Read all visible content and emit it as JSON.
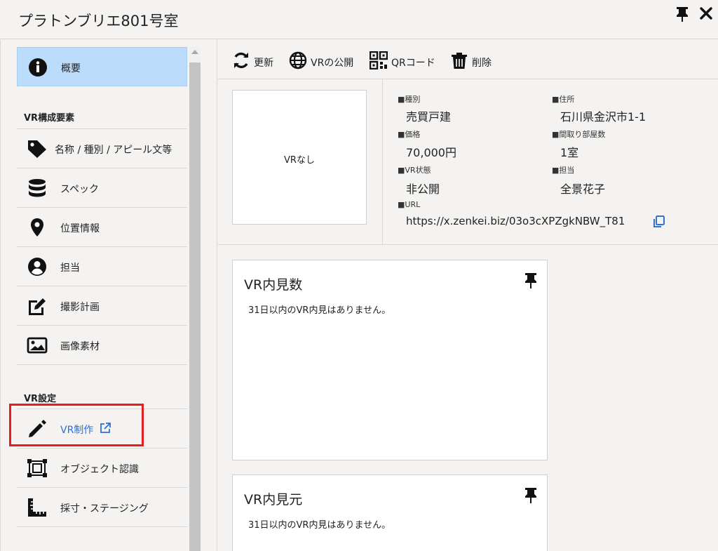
{
  "window": {
    "title": "プラトンブリエ801号室"
  },
  "sidebar": {
    "top_item": {
      "label": "概要",
      "icon": "info-circle-icon"
    },
    "section1": "VR構成要素",
    "section1_items": [
      {
        "label": "名称 / 種別 / アピール文等",
        "icon": "tag-icon"
      },
      {
        "label": "スペック",
        "icon": "database-icon"
      },
      {
        "label": "位置情報",
        "icon": "map-marker-icon"
      },
      {
        "label": "担当",
        "icon": "user-circle-icon"
      },
      {
        "label": "撮影計画",
        "icon": "edit-icon"
      },
      {
        "label": "画像素材",
        "icon": "image-icon"
      }
    ],
    "section2": "VR設定",
    "section2_items": [
      {
        "label": "VR制作",
        "icon": "pencil-icon",
        "trailing_icon": "external-link-icon"
      },
      {
        "label": "オブジェクト認識",
        "icon": "object-recognition-icon"
      },
      {
        "label": "採寸・ステージング",
        "icon": "ruler-icon"
      }
    ]
  },
  "toolbar": {
    "buttons": [
      {
        "label": "更新",
        "icon": "refresh-icon"
      },
      {
        "label": "VRの公開",
        "icon": "globe-icon"
      },
      {
        "label": "QRコード",
        "icon": "qr-code-icon"
      },
      {
        "label": "削除",
        "icon": "trash-icon"
      }
    ]
  },
  "info": {
    "thumbnail_label": "VRなし",
    "fields": {
      "type_label": "■種別",
      "type_value": "売買戸建",
      "address_label": "■住所",
      "address_value": "石川県金沢市1-1",
      "price_label": "■価格",
      "price_value": "70,000円",
      "rooms_label": "■間取り部屋数",
      "rooms_value": "1室",
      "vr_status_label": "■VR状態",
      "vr_status_value": "非公開",
      "staff_label": "■担当",
      "staff_value": "全景花子",
      "url_label": "■URL",
      "url_value": "https://x.zenkei.biz/03o3cXPZgkNBW_T81"
    }
  },
  "cards": [
    {
      "title": "VR内見数",
      "body": "31日以内のVR内見はありません。"
    },
    {
      "title": "VR内見元",
      "body": "31日以内のVR内見はありません。"
    }
  ],
  "colors": {
    "active_nav": "#bcdcfb",
    "link": "#2f6fd6",
    "highlight": "#e61e1e",
    "copy_icon": "#2f6fd6"
  }
}
